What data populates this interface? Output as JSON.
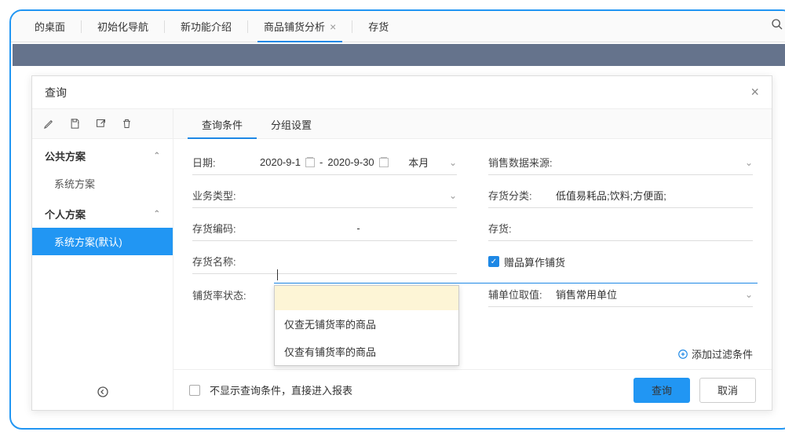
{
  "topTabs": {
    "t0": "的桌面",
    "t1": "初始化导航",
    "t2": "新功能介绍",
    "t3": "商品铺货分析",
    "t4": "存货"
  },
  "modal": {
    "title": "查询",
    "innerTabs": {
      "a": "查询条件",
      "b": "分组设置"
    }
  },
  "sidebar": {
    "groupA": "公共方案",
    "itemA1": "系统方案",
    "groupB": "个人方案",
    "itemB1": "系统方案(默认)"
  },
  "form": {
    "dateLabel": "日期:",
    "dateStart": "2020-9-1",
    "dateSep": "-",
    "dateEnd": "2020-9-30",
    "dateRange": "本月",
    "bizTypeLabel": "业务类型:",
    "invCodeLabel": "存货编码:",
    "invCodeValue": "-",
    "invNameLabel": "存货名称:",
    "distribStatusLabel": "铺货率状态:",
    "salesSourceLabel": "销售数据来源:",
    "invCatLabel": "存货分类:",
    "invCatValue": "低值易耗品;饮料;方便面;",
    "stockLabel": "存货:",
    "giftAsDistrib": "赠品算作铺货",
    "auxUnitLabel": "辅单位取值:",
    "auxUnitValue": "销售常用单位"
  },
  "dropdown": {
    "opt1": "仅查无铺货率的商品",
    "opt2": "仅查有铺货率的商品"
  },
  "actions": {
    "addFilter": "添加过滤条件",
    "skipQuery": "不显示查询条件，直接进入报表",
    "query": "查询",
    "cancel": "取消"
  }
}
